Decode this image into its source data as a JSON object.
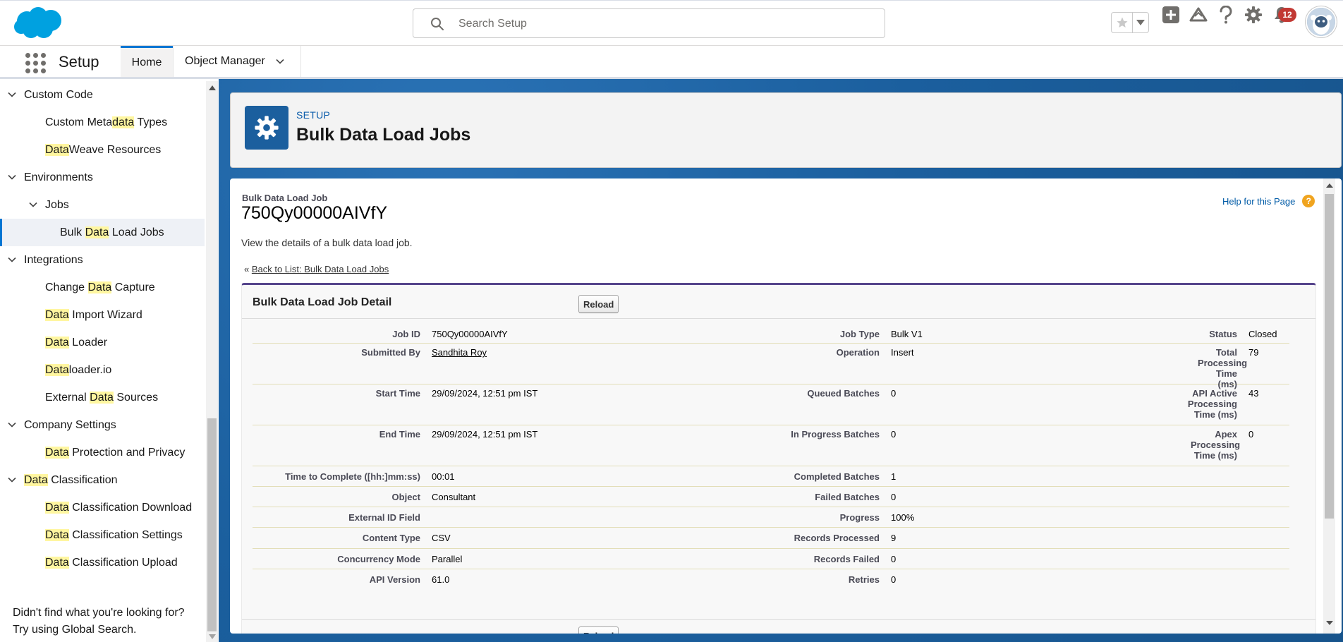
{
  "header": {
    "search_placeholder": "Search Setup",
    "notification_count": "12"
  },
  "nav": {
    "app_name": "Setup",
    "tabs": [
      {
        "label": "Home"
      },
      {
        "label": "Object Manager"
      }
    ]
  },
  "sidebar": {
    "items": [
      {
        "pre": "",
        "hl": "",
        "post": "Custom Code"
      },
      {
        "pre": "Custom Meta",
        "hl": "data",
        "post": " Types"
      },
      {
        "pre": "",
        "hl": "Data",
        "post": "Weave Resources"
      },
      {
        "pre": "",
        "hl": "",
        "post": "Environments"
      },
      {
        "pre": "",
        "hl": "",
        "post": "Jobs"
      },
      {
        "pre": "Bulk ",
        "hl": "Data",
        "post": " Load Jobs"
      },
      {
        "pre": "",
        "hl": "",
        "post": "Integrations"
      },
      {
        "pre": "Change ",
        "hl": "Data",
        "post": " Capture"
      },
      {
        "pre": "",
        "hl": "Data",
        "post": " Import Wizard"
      },
      {
        "pre": "",
        "hl": "Data",
        "post": " Loader"
      },
      {
        "pre": "",
        "hl": "Data",
        "post": "loader.io"
      },
      {
        "pre": "External ",
        "hl": "Data",
        "post": " Sources"
      },
      {
        "pre": "",
        "hl": "",
        "post": "Company Settings"
      },
      {
        "pre": "",
        "hl": "Data",
        "post": " Protection and Privacy"
      },
      {
        "pre": "",
        "hl": "Data",
        "post": " Classification"
      },
      {
        "pre": "",
        "hl": "Data",
        "post": " Classification Download"
      },
      {
        "pre": "",
        "hl": "Data",
        "post": " Classification Settings"
      },
      {
        "pre": "",
        "hl": "Data",
        "post": " Classification Upload"
      }
    ],
    "footer_line1": "Didn't find what you're looking for?",
    "footer_line2": "Try using Global Search."
  },
  "page_header": {
    "eyebrow": "SETUP",
    "title": "Bulk Data Load Jobs"
  },
  "content": {
    "record_type": "Bulk Data Load Job",
    "record_id": "750Qy00000AIVfY",
    "help_link": "Help for this Page",
    "help_icon_glyph": "?",
    "description": "View the details of a bulk data load job.",
    "back_prefix": "« ",
    "back_link": "Back to List: Bulk Data Load Jobs",
    "detail_title": "Bulk Data Load Job Detail",
    "reload_label": "Reload"
  },
  "detail": {
    "job_id": {
      "label": "Job ID",
      "value": "750Qy00000AIVfY"
    },
    "job_type": {
      "label": "Job Type",
      "value": "Bulk V1"
    },
    "status": {
      "label": "Status",
      "value": "Closed"
    },
    "submitted_by": {
      "label": "Submitted By",
      "value": "Sandhita Roy"
    },
    "operation": {
      "label": "Operation",
      "value": "Insert"
    },
    "total_processing_time": {
      "label": "Total Processing Time (ms)",
      "value": "79"
    },
    "start_time": {
      "label": "Start Time",
      "value": "29/09/2024, 12:51 pm IST"
    },
    "queued_batches": {
      "label": "Queued Batches",
      "value": "0"
    },
    "api_active_processing_time": {
      "label": "API Active Processing Time (ms)",
      "value": "43"
    },
    "end_time": {
      "label": "End Time",
      "value": "29/09/2024, 12:51 pm IST"
    },
    "in_progress_batches": {
      "label": "In Progress Batches",
      "value": "0"
    },
    "apex_processing_time": {
      "label": "Apex Processing Time (ms)",
      "value": "0"
    },
    "time_to_complete": {
      "label": "Time to Complete ([hh:]mm:ss)",
      "value": "00:01"
    },
    "completed_batches": {
      "label": "Completed Batches",
      "value": "1"
    },
    "object": {
      "label": "Object",
      "value": "Consultant"
    },
    "failed_batches": {
      "label": "Failed Batches",
      "value": "0"
    },
    "external_id_field": {
      "label": "External ID Field",
      "value": ""
    },
    "progress": {
      "label": "Progress",
      "value": "100%"
    },
    "content_type": {
      "label": "Content Type",
      "value": "CSV"
    },
    "records_processed": {
      "label": "Records Processed",
      "value": "9"
    },
    "concurrency_mode": {
      "label": "Concurrency Mode",
      "value": "Parallel"
    },
    "records_failed": {
      "label": "Records Failed",
      "value": "0"
    },
    "api_version": {
      "label": "API Version",
      "value": "61.0"
    },
    "retries": {
      "label": "Retries",
      "value": "0"
    }
  },
  "colors": {
    "brand_blue": "#0176d3",
    "page_icon_bg": "#1b5f9e",
    "detail_accent": "#56458c",
    "badge_red": "#c23934"
  }
}
